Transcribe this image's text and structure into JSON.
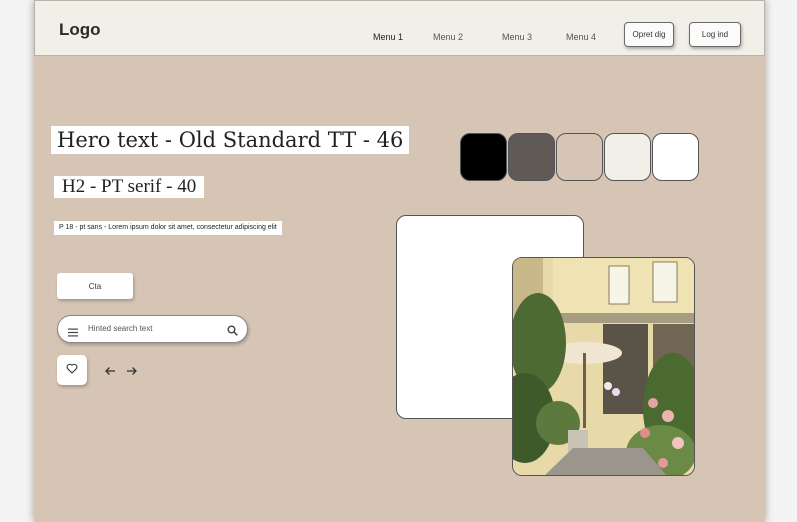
{
  "header": {
    "logo": "Logo",
    "menu": [
      "Menu 1",
      "Menu 2",
      "Menu 3",
      "Menu 4"
    ],
    "signup_label": "Opret dig",
    "login_label": "Log ind"
  },
  "typography": {
    "hero": "Hero text - Old Standard TT - 46",
    "h2": "H2 - PT serif - 40",
    "paragraph": "P 18 - pt sans - Lorem ipsum dolor sit amet, consectetur adipiscing elit"
  },
  "components": {
    "cta_label": "Cta",
    "search_placeholder": "Hinted search text"
  },
  "palette": [
    "#000000",
    "#605a57",
    "#d6c5b5",
    "#f2efe9",
    "#ffffff"
  ],
  "icons": [
    "menu-icon",
    "search-icon",
    "heart-icon",
    "arrow-left-icon",
    "arrow-right-icon"
  ]
}
